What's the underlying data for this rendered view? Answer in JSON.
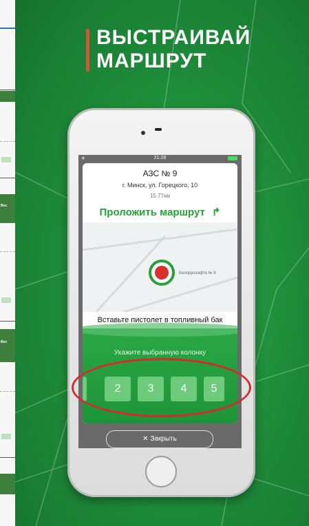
{
  "promo": {
    "headline_line1": "ВЫСТРАИВАЙ",
    "headline_line2": "МАРШРУТ",
    "accent_color": "#d2563a",
    "background_color": "#1f8f3b"
  },
  "status_bar": {
    "time": "21:28"
  },
  "station": {
    "name": "АЗС № 9",
    "address": "г. Минск, ул. Горецкого, 10",
    "distance": "15.77км"
  },
  "route_button": {
    "label": "Проложить маршрут",
    "icon": "arrow-turn-right-icon"
  },
  "map": {
    "pin_label": "Белоруснафта № 9"
  },
  "instructions": {
    "insert_nozzle": "Вставьте пистолет в топливный бак",
    "select_pump": "Укажите выбранную колонку"
  },
  "pumps": [
    "2",
    "3",
    "4",
    "5"
  ],
  "close_button": {
    "label": "✕ Закрыть"
  },
  "left_strip": {
    "tag_text": "Вес"
  }
}
